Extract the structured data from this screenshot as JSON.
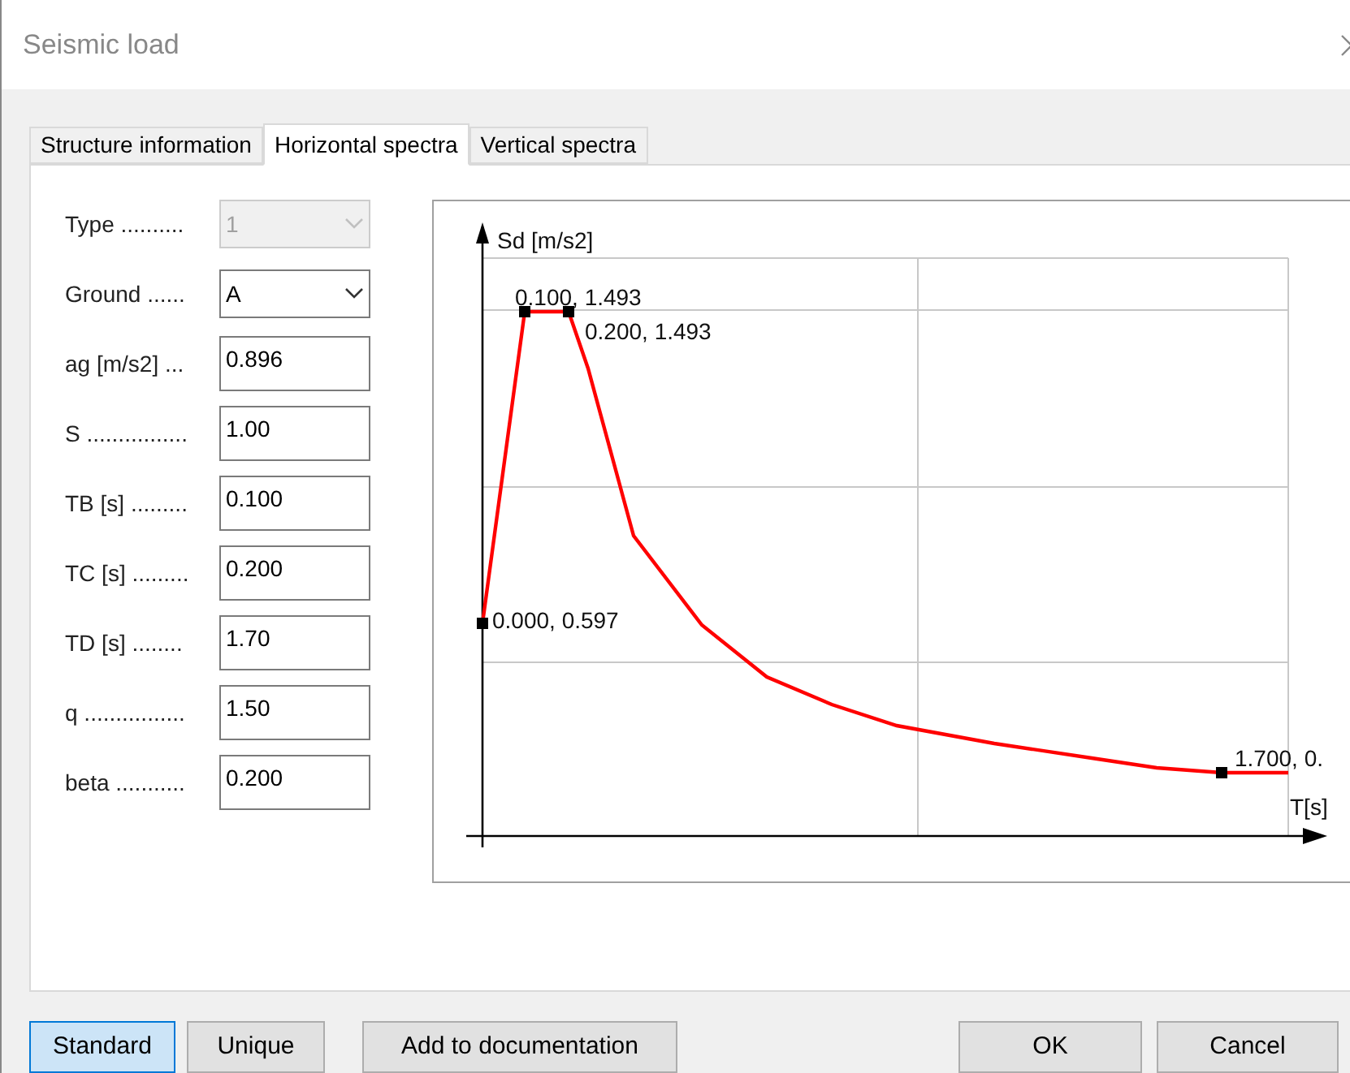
{
  "window": {
    "title": "Seismic load"
  },
  "tabs": [
    {
      "label": "Structure information",
      "selected": false
    },
    {
      "label": "Horizontal spectra",
      "selected": true
    },
    {
      "label": "Vertical spectra",
      "selected": false
    }
  ],
  "fields": [
    {
      "label": "Type ..........",
      "value": "1",
      "kind": "select",
      "disabled": true
    },
    {
      "label": "Ground ......",
      "value": "A",
      "kind": "select",
      "disabled": false
    },
    {
      "label": "ag [m/s2] ...",
      "value": "0.896",
      "kind": "input",
      "disabled": false
    },
    {
      "label": "S ................",
      "value": "1.00",
      "kind": "input",
      "disabled": false
    },
    {
      "label": "TB [s] .........",
      "value": "0.100",
      "kind": "input",
      "disabled": false
    },
    {
      "label": "TC [s] .........",
      "value": "0.200",
      "kind": "input",
      "disabled": false
    },
    {
      "label": "TD [s] ........",
      "value": "1.70",
      "kind": "input",
      "disabled": false
    },
    {
      "label": "q ................",
      "value": "1.50",
      "kind": "input",
      "disabled": false
    },
    {
      "label": "beta ...........",
      "value": "0.200",
      "kind": "input",
      "disabled": false
    }
  ],
  "chart": {
    "ylabel": "Sd [m/s2]",
    "xlabel": "T[s]",
    "point_labels": [
      "0.100, 1.493",
      "0.200, 1.493",
      "0.000, 0.597",
      "1.700, 0."
    ]
  },
  "mode_buttons": [
    {
      "label": "Standard",
      "selected": true
    },
    {
      "label": "Unique",
      "selected": false
    }
  ],
  "doc_button": "Add to documentation",
  "ok_button": "OK",
  "cancel_button": "Cancel"
}
